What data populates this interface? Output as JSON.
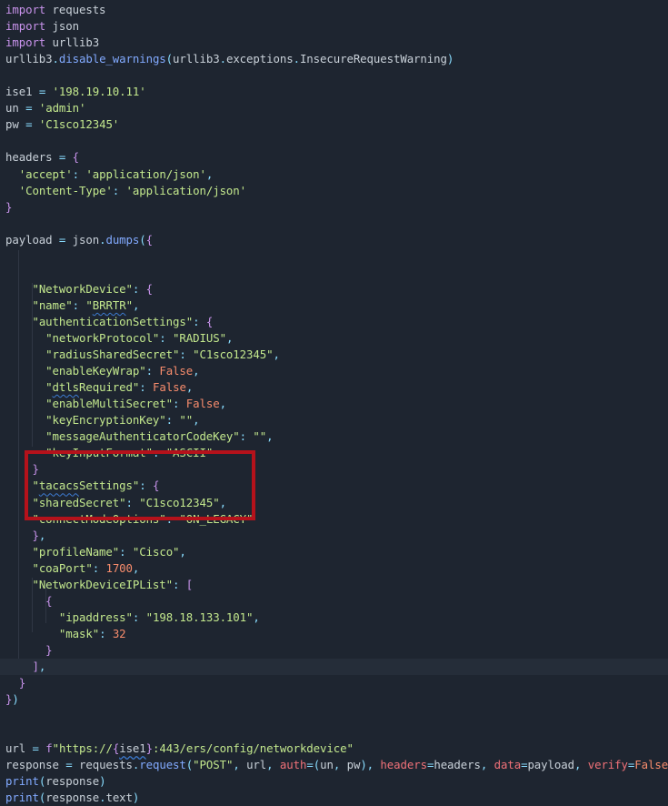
{
  "editor": {
    "theme": {
      "background": "#1e2530",
      "highlight_box_color": "#b5121b"
    },
    "lines": [
      [
        [
          "kw",
          "import"
        ],
        [
          "id",
          " requests"
        ]
      ],
      [
        [
          "kw",
          "import"
        ],
        [
          "id",
          " json"
        ]
      ],
      [
        [
          "kw",
          "import"
        ],
        [
          "id",
          " urllib3"
        ]
      ],
      [
        [
          "id",
          "urllib3"
        ],
        [
          "punc",
          "."
        ],
        [
          "fn",
          "disable_warnings"
        ],
        [
          "punc",
          "("
        ],
        [
          "id",
          "urllib3"
        ],
        [
          "punc",
          "."
        ],
        [
          "id",
          "exceptions"
        ],
        [
          "punc",
          "."
        ],
        [
          "id",
          "InsecureRequestWarning"
        ],
        [
          "punc",
          ")"
        ]
      ],
      [],
      [
        [
          "id",
          "ise1 "
        ],
        [
          "op",
          "="
        ],
        [
          "id",
          " "
        ],
        [
          "str",
          "'198.19.10.11'"
        ]
      ],
      [
        [
          "id",
          "un "
        ],
        [
          "op",
          "="
        ],
        [
          "id",
          " "
        ],
        [
          "str",
          "'admin'"
        ]
      ],
      [
        [
          "id",
          "pw "
        ],
        [
          "op",
          "="
        ],
        [
          "id",
          " "
        ],
        [
          "str",
          "'C1sco12345'"
        ]
      ],
      [],
      [
        [
          "id",
          "headers "
        ],
        [
          "op",
          "="
        ],
        [
          "id",
          " "
        ],
        [
          "brace",
          "{"
        ]
      ],
      [
        [
          "id",
          "  "
        ],
        [
          "str",
          "'accept'"
        ],
        [
          "punc",
          ":"
        ],
        [
          "id",
          " "
        ],
        [
          "str",
          "'application/json'"
        ],
        [
          "punc",
          ","
        ]
      ],
      [
        [
          "id",
          "  "
        ],
        [
          "str",
          "'Content-Type'"
        ],
        [
          "punc",
          ":"
        ],
        [
          "id",
          " "
        ],
        [
          "str",
          "'application/json'"
        ]
      ],
      [
        [
          "brace",
          "}"
        ]
      ],
      [],
      [
        [
          "id",
          "payload "
        ],
        [
          "op",
          "="
        ],
        [
          "id",
          " json"
        ],
        [
          "punc",
          "."
        ],
        [
          "fn",
          "dumps"
        ],
        [
          "punc",
          "("
        ],
        [
          "brace",
          "{"
        ]
      ],
      [],
      [],
      [
        [
          "id",
          "    "
        ],
        [
          "key",
          "\"NetworkDevice\""
        ],
        [
          "punc",
          ":"
        ],
        [
          "id",
          " "
        ],
        [
          "brace",
          "{"
        ]
      ],
      [
        [
          "id",
          "    "
        ],
        [
          "key",
          "\"name\""
        ],
        [
          "punc",
          ":"
        ],
        [
          "id",
          " "
        ],
        [
          "str",
          "\""
        ],
        [
          "sq",
          "BRRTR"
        ],
        [
          "str",
          "\""
        ],
        [
          "punc",
          ","
        ]
      ],
      [
        [
          "id",
          "    "
        ],
        [
          "key",
          "\"authenticationSettings\""
        ],
        [
          "punc",
          ":"
        ],
        [
          "id",
          " "
        ],
        [
          "brace",
          "{"
        ]
      ],
      [
        [
          "id",
          "      "
        ],
        [
          "key",
          "\"networkProtocol\""
        ],
        [
          "punc",
          ":"
        ],
        [
          "id",
          " "
        ],
        [
          "str",
          "\"RADIUS\""
        ],
        [
          "punc",
          ","
        ]
      ],
      [
        [
          "id",
          "      "
        ],
        [
          "key",
          "\"radiusSharedSecret\""
        ],
        [
          "punc",
          ":"
        ],
        [
          "id",
          " "
        ],
        [
          "str",
          "\"C1sco12345\""
        ],
        [
          "punc",
          ","
        ]
      ],
      [
        [
          "id",
          "      "
        ],
        [
          "key",
          "\"enableKeyWrap\""
        ],
        [
          "punc",
          ":"
        ],
        [
          "id",
          " "
        ],
        [
          "const",
          "False"
        ],
        [
          "punc",
          ","
        ]
      ],
      [
        [
          "id",
          "      "
        ],
        [
          "key",
          "\""
        ],
        [
          "sq",
          "dtls"
        ],
        [
          "key",
          "Required\""
        ],
        [
          "punc",
          ":"
        ],
        [
          "id",
          " "
        ],
        [
          "const",
          "False"
        ],
        [
          "punc",
          ","
        ]
      ],
      [
        [
          "id",
          "      "
        ],
        [
          "key",
          "\"enableMultiSecret\""
        ],
        [
          "punc",
          ":"
        ],
        [
          "id",
          " "
        ],
        [
          "const",
          "False"
        ],
        [
          "punc",
          ","
        ]
      ],
      [
        [
          "id",
          "      "
        ],
        [
          "key",
          "\"keyEncryptionKey\""
        ],
        [
          "punc",
          ":"
        ],
        [
          "id",
          " "
        ],
        [
          "str",
          "\"\""
        ],
        [
          "punc",
          ","
        ]
      ],
      [
        [
          "id",
          "      "
        ],
        [
          "key",
          "\"messageAuthenticatorCodeKey\""
        ],
        [
          "punc",
          ":"
        ],
        [
          "id",
          " "
        ],
        [
          "str",
          "\"\""
        ],
        [
          "punc",
          ","
        ]
      ],
      [
        [
          "id",
          "      "
        ],
        [
          "key",
          "\"keyInputFormat\""
        ],
        [
          "punc",
          ":"
        ],
        [
          "id",
          " "
        ],
        [
          "str",
          "\"ASCII\""
        ]
      ],
      [
        [
          "id",
          "    "
        ],
        [
          "brace",
          "}"
        ]
      ],
      [
        [
          "id",
          "    "
        ],
        [
          "key",
          "\""
        ],
        [
          "sq",
          "tacacs"
        ],
        [
          "key",
          "Settings\""
        ],
        [
          "punc",
          ":"
        ],
        [
          "id",
          " "
        ],
        [
          "brace",
          "{"
        ]
      ],
      [
        [
          "id",
          "    "
        ],
        [
          "key",
          "\"sharedSecret\""
        ],
        [
          "punc",
          ":"
        ],
        [
          "id",
          " "
        ],
        [
          "str",
          "\"C1sco12345\""
        ],
        [
          "punc",
          ","
        ]
      ],
      [
        [
          "id",
          "    "
        ],
        [
          "key",
          "\"connectModeOptions\""
        ],
        [
          "punc",
          ":"
        ],
        [
          "id",
          " "
        ],
        [
          "str",
          "\"ON_LEGACY\""
        ]
      ],
      [
        [
          "id",
          "    "
        ],
        [
          "brace",
          "}"
        ],
        [
          "punc",
          ","
        ]
      ],
      [
        [
          "id",
          "    "
        ],
        [
          "key",
          "\"profileName\""
        ],
        [
          "punc",
          ":"
        ],
        [
          "id",
          " "
        ],
        [
          "str",
          "\"Cisco\""
        ],
        [
          "punc",
          ","
        ]
      ],
      [
        [
          "id",
          "    "
        ],
        [
          "key",
          "\"coaPort\""
        ],
        [
          "punc",
          ":"
        ],
        [
          "id",
          " "
        ],
        [
          "num",
          "1700"
        ],
        [
          "punc",
          ","
        ]
      ],
      [
        [
          "id",
          "    "
        ],
        [
          "key",
          "\"NetworkDeviceIPList\""
        ],
        [
          "punc",
          ":"
        ],
        [
          "id",
          " "
        ],
        [
          "brace",
          "["
        ]
      ],
      [
        [
          "id",
          "      "
        ],
        [
          "brace",
          "{"
        ]
      ],
      [
        [
          "id",
          "        "
        ],
        [
          "key",
          "\"ipaddress\""
        ],
        [
          "punc",
          ":"
        ],
        [
          "id",
          " "
        ],
        [
          "str",
          "\"198.18.133.101\""
        ],
        [
          "punc",
          ","
        ]
      ],
      [
        [
          "id",
          "        "
        ],
        [
          "key",
          "\"mask\""
        ],
        [
          "punc",
          ":"
        ],
        [
          "id",
          " "
        ],
        [
          "num",
          "32"
        ]
      ],
      [
        [
          "id",
          "      "
        ],
        [
          "brace",
          "}"
        ]
      ],
      [
        [
          "id",
          "    "
        ],
        [
          "brace",
          "]"
        ],
        [
          "punc",
          ","
        ]
      ],
      [
        [
          "id",
          "  "
        ],
        [
          "brace",
          "}"
        ]
      ],
      [
        [
          "brace",
          "}"
        ],
        [
          "punc",
          ")"
        ]
      ],
      [],
      [],
      [
        [
          "id",
          "url "
        ],
        [
          "op",
          "="
        ],
        [
          "id",
          " "
        ],
        [
          "kw",
          "f"
        ],
        [
          "str",
          "\"https://"
        ],
        [
          "brace",
          "{"
        ],
        [
          "interp",
          "ise1"
        ],
        [
          "brace",
          "}"
        ],
        [
          "str",
          ":443/ers/config/networkdevice\""
        ]
      ],
      [
        [
          "id",
          "response "
        ],
        [
          "op",
          "="
        ],
        [
          "id",
          " requests"
        ],
        [
          "punc",
          "."
        ],
        [
          "fn",
          "request"
        ],
        [
          "punc",
          "("
        ],
        [
          "str",
          "\"POST\""
        ],
        [
          "punc",
          ","
        ],
        [
          "id",
          " url"
        ],
        [
          "punc",
          ","
        ],
        [
          "id",
          " "
        ],
        [
          "param",
          "auth"
        ],
        [
          "op",
          "="
        ],
        [
          "punc",
          "("
        ],
        [
          "id",
          "un"
        ],
        [
          "punc",
          ","
        ],
        [
          "id",
          " pw"
        ],
        [
          "punc",
          "),"
        ],
        [
          "id",
          " "
        ],
        [
          "param",
          "headers"
        ],
        [
          "op",
          "="
        ],
        [
          "id",
          "headers"
        ],
        [
          "punc",
          ","
        ],
        [
          "id",
          " "
        ],
        [
          "param",
          "data"
        ],
        [
          "op",
          "="
        ],
        [
          "id",
          "payload"
        ],
        [
          "punc",
          ","
        ],
        [
          "id",
          " "
        ],
        [
          "param",
          "verify"
        ],
        [
          "op",
          "="
        ],
        [
          "const",
          "False"
        ],
        [
          "punc",
          ")"
        ]
      ],
      [
        [
          "fn",
          "print"
        ],
        [
          "punc",
          "("
        ],
        [
          "id",
          "response"
        ],
        [
          "punc",
          ")"
        ]
      ],
      [
        [
          "fn",
          "print"
        ],
        [
          "punc",
          "("
        ],
        [
          "id",
          "response"
        ],
        [
          "punc",
          "."
        ],
        [
          "id",
          "text"
        ],
        [
          "punc",
          ")"
        ]
      ]
    ],
    "active_line": 40
  }
}
